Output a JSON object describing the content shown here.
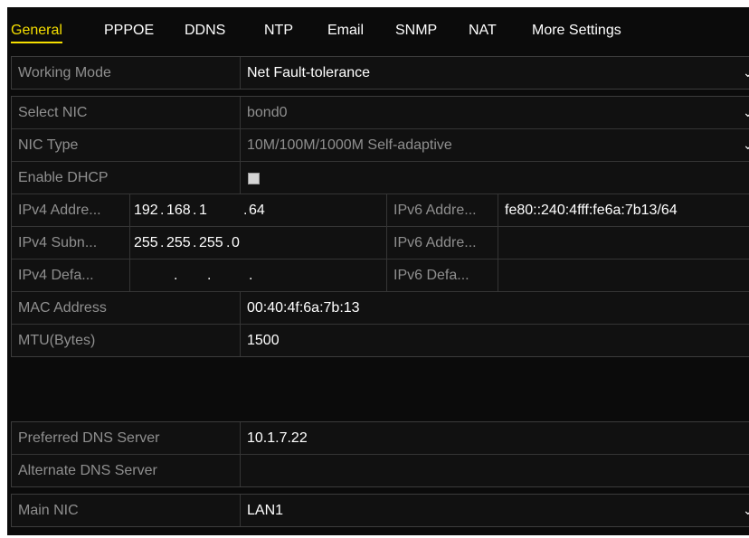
{
  "tabs": [
    {
      "label": "General",
      "active": true
    },
    {
      "label": "PPPOE"
    },
    {
      "label": "DDNS"
    },
    {
      "label": "NTP"
    },
    {
      "label": "Email"
    },
    {
      "label": "SNMP"
    },
    {
      "label": "NAT"
    },
    {
      "label": "More Settings"
    }
  ],
  "working_mode": {
    "label": "Working Mode",
    "value": "Net Fault-tolerance"
  },
  "select_nic": {
    "label": "Select NIC",
    "value": "bond0"
  },
  "nic_type": {
    "label": "NIC Type",
    "value": "10M/100M/1000M Self-adaptive"
  },
  "dhcp": {
    "label": "Enable DHCP",
    "checked": false
  },
  "ipv4": {
    "address_label": "IPv4 Addre...",
    "address": [
      "192",
      "168",
      "1",
      "64"
    ],
    "subnet_label": "IPv4 Subn...",
    "subnet": [
      "255",
      "255",
      "255",
      "0"
    ],
    "gateway_label": "IPv4 Defa...",
    "gateway": [
      "",
      "",
      "",
      ""
    ]
  },
  "ipv6": {
    "address1_label": "IPv6 Addre...",
    "address1": "fe80::240:4fff:fe6a:7b13/64",
    "address2_label": "IPv6 Addre...",
    "address2": "",
    "gateway_label": "IPv6 Defa...",
    "gateway": ""
  },
  "mac": {
    "label": "MAC Address",
    "value": "00:40:4f:6a:7b:13"
  },
  "mtu": {
    "label": "MTU(Bytes)",
    "value": "1500"
  },
  "dns": {
    "preferred_label": "Preferred DNS Server",
    "preferred": "10.1.7.22",
    "alternate_label": "Alternate DNS Server",
    "alternate": ""
  },
  "main_nic": {
    "label": "Main NIC",
    "value": "LAN1"
  },
  "icons": {
    "dropdown": "chevron-down-icon",
    "checkbox": "checkbox-unchecked-icon"
  },
  "colors": {
    "background": "#0b0b0b",
    "active_tab": "#f6df00",
    "label": "#8f8f8f",
    "value": "#ffffff",
    "border": "#353535"
  }
}
